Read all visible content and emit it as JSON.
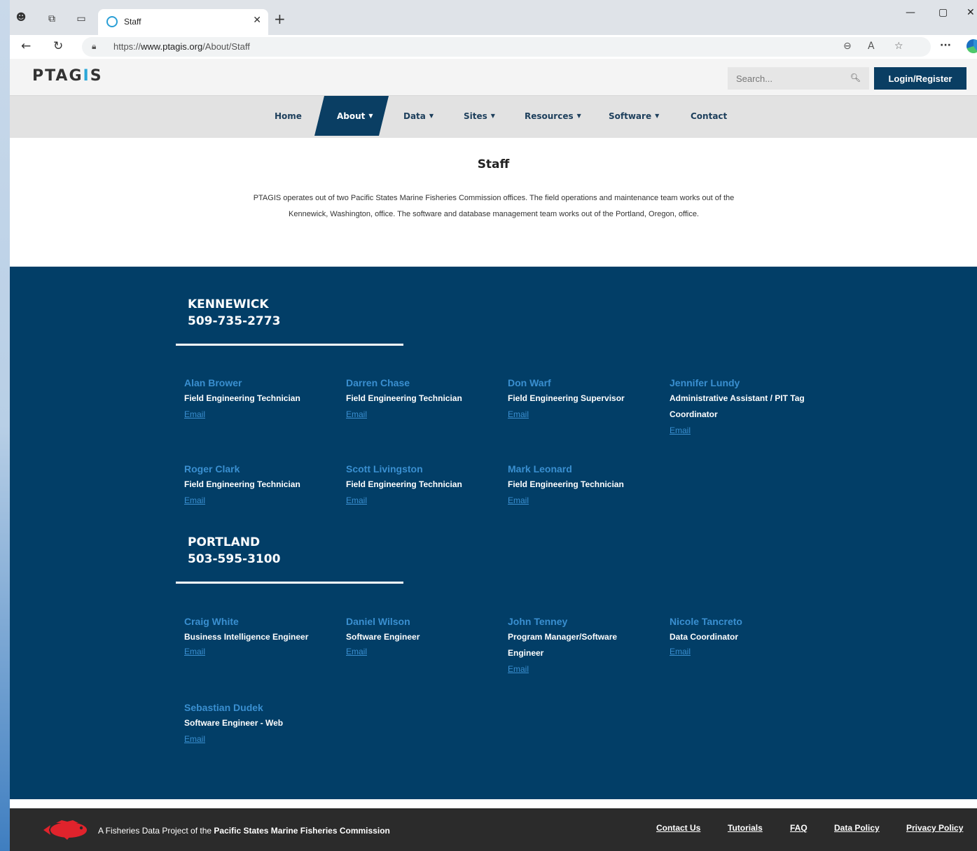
{
  "browser": {
    "tab_title": "Staff",
    "url_prefix": "https://",
    "url_domain": "www.ptagis.org",
    "url_path": "/About/Staff"
  },
  "header": {
    "logo_main": "PTAG",
    "logo_accent": "I",
    "logo_end": "S",
    "search_placeholder": "Search...",
    "login_label": "Login/Register"
  },
  "nav": [
    {
      "label": "Home",
      "dropdown": false
    },
    {
      "label": "About",
      "dropdown": true,
      "active": true
    },
    {
      "label": "Data",
      "dropdown": true
    },
    {
      "label": "Sites",
      "dropdown": true
    },
    {
      "label": "Resources",
      "dropdown": true
    },
    {
      "label": "Software",
      "dropdown": true
    },
    {
      "label": "Contact",
      "dropdown": false
    }
  ],
  "page": {
    "title": "Staff",
    "intro": "PTAGIS operates out of two Pacific States Marine Fisheries Commission offices. The field operations and maintenance team works out of the Kennewick, Washington, office. The software and database management team works out of the Portland, Oregon, office."
  },
  "offices": [
    {
      "name": "KENNEWICK",
      "phone": "509-735-2773",
      "staff": [
        {
          "name": "Alan Brower",
          "role": "Field Engineering Technician",
          "email_label": "Email"
        },
        {
          "name": "Darren Chase",
          "role": "Field Engineering Technician",
          "email_label": "Email"
        },
        {
          "name": "Don Warf",
          "role": "Field Engineering Supervisor",
          "email_label": "Email"
        },
        {
          "name": "Jennifer Lundy",
          "role": "Administrative Assistant / PIT Tag Coordinator",
          "email_label": "Email"
        },
        {
          "name": "Roger Clark",
          "role": "Field Engineering Technician",
          "email_label": "Email"
        },
        {
          "name": "Scott Livingston",
          "role": "Field Engineering Technician",
          "email_label": "Email"
        },
        {
          "name": "Mark Leonard",
          "role": "Field Engineering Technician",
          "email_label": "Email"
        }
      ]
    },
    {
      "name": "PORTLAND",
      "phone": "503-595-3100",
      "staff": [
        {
          "name": "Craig White",
          "role": "Business Intelligence Engineer",
          "email_label": "Email"
        },
        {
          "name": "Daniel Wilson",
          "role": "Software Engineer",
          "email_label": "Email"
        },
        {
          "name": "John Tenney",
          "role": "Program Manager/Software Engineer",
          "email_label": "Email"
        },
        {
          "name": "Nicole Tancreto",
          "role": "Data Coordinator",
          "email_label": "Email"
        },
        {
          "name": "Sebastian Dudek",
          "role": "Software Engineer - Web",
          "email_label": "Email"
        }
      ]
    }
  ],
  "footer": {
    "text_prefix": "A Fisheries Data Project of the ",
    "text_org": "Pacific States Marine Fisheries Commission",
    "links": [
      "Contact Us",
      "Tutorials",
      "FAQ",
      "Data Policy",
      "Privacy Policy"
    ]
  },
  "colors": {
    "navy": "#023e67",
    "link_blue": "#3a8fd0",
    "logo_accent": "#2aa7d8",
    "footer_bg": "#2b2b2b"
  }
}
